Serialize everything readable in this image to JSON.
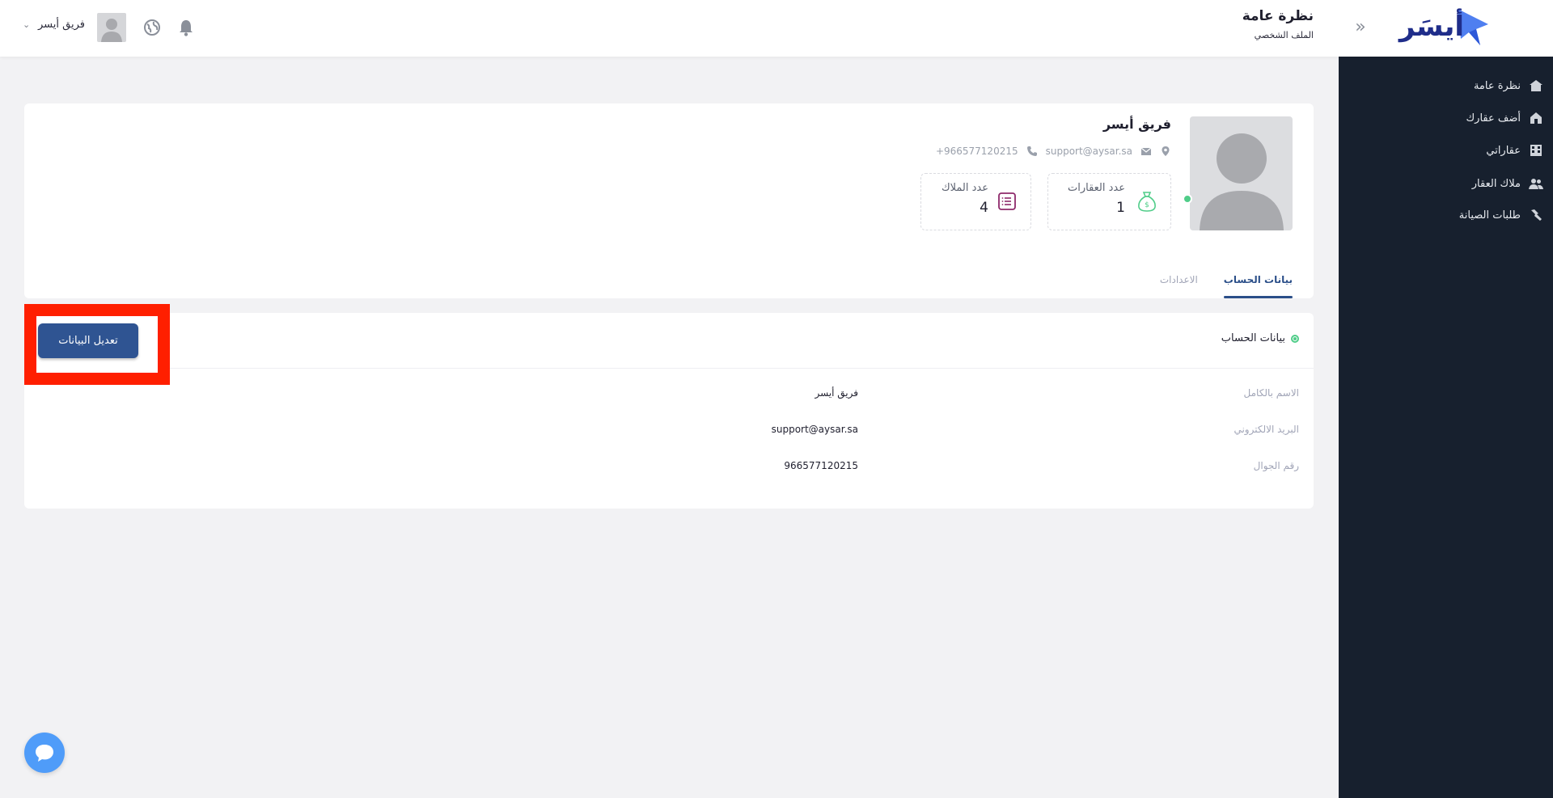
{
  "header": {
    "logo_text": "أيسَر",
    "page_title": "نظرة عامة",
    "breadcrumb": "الملف الشخصي",
    "user_name": "فريق أيسر",
    "caret": "⌄",
    "collapse_icon": "«"
  },
  "sidebar": {
    "items": [
      {
        "label": "نظرة عامة",
        "icon": "home-icon"
      },
      {
        "label": "أضف عقارك",
        "icon": "house-add-icon"
      },
      {
        "label": "عقاراتي",
        "icon": "building-icon"
      },
      {
        "label": "ملاك العقار",
        "icon": "users-icon"
      },
      {
        "label": "طلبات الصيانة",
        "icon": "wrench-icon"
      }
    ]
  },
  "profile": {
    "name": "فريق أيسر",
    "email": "support@aysar.sa",
    "phone": "+966577120215",
    "stats": [
      {
        "label": "عدد العقارات",
        "value": "1",
        "icon": "money-bag-icon"
      },
      {
        "label": "عدد الملاك",
        "value": "4",
        "icon": "list-icon"
      }
    ]
  },
  "tabs": [
    {
      "label": "بيانات الحساب",
      "active": true
    },
    {
      "label": "الاعدادات",
      "active": false
    }
  ],
  "account": {
    "section_title": "بيانات الحساب",
    "edit_button": "تعديل البيانات",
    "fields": [
      {
        "label": "الاسم بالكامل",
        "value": "فريق أيسر"
      },
      {
        "label": "البريد الالكتروني",
        "value": "support@aysar.sa"
      },
      {
        "label": "رقم الجوال",
        "value": "966577120215"
      }
    ]
  },
  "colors": {
    "sidebar_bg": "#17202e",
    "brand_blue": "#2f5492",
    "highlight_red": "#ff1f00",
    "online_green": "#50cd89",
    "chat_blue": "#4f9cf9"
  }
}
